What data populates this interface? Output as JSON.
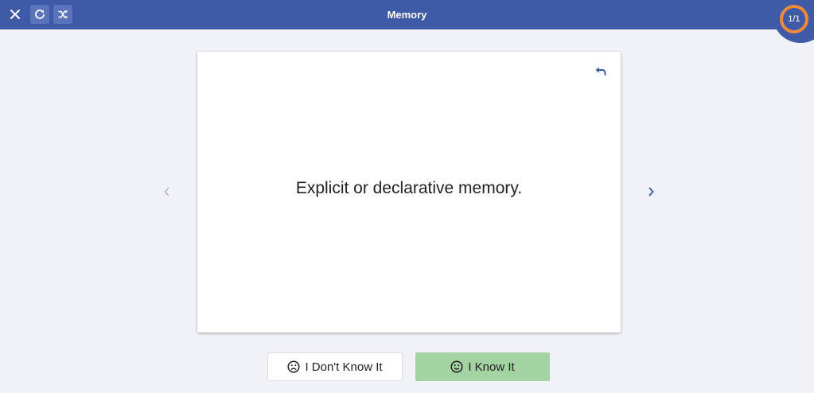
{
  "header": {
    "title": "Memory",
    "counter": "1/1",
    "close_icon": "close-icon",
    "restart_icon": "restart-icon",
    "shuffle_icon": "shuffle-icon"
  },
  "card": {
    "text": "Explicit or declarative memory.",
    "flip_icon": "undo-icon"
  },
  "navigation": {
    "prev_icon": "chevron-left-icon",
    "next_icon": "chevron-right-icon"
  },
  "answers": {
    "dont_know_label": "I Don't Know It",
    "know_label": "I Know It"
  },
  "colors": {
    "header_bg": "#3f5aa6",
    "page_bg": "#f1f2f7",
    "counter_ring": "#f0893a",
    "know_button": "#a3d3a3"
  }
}
